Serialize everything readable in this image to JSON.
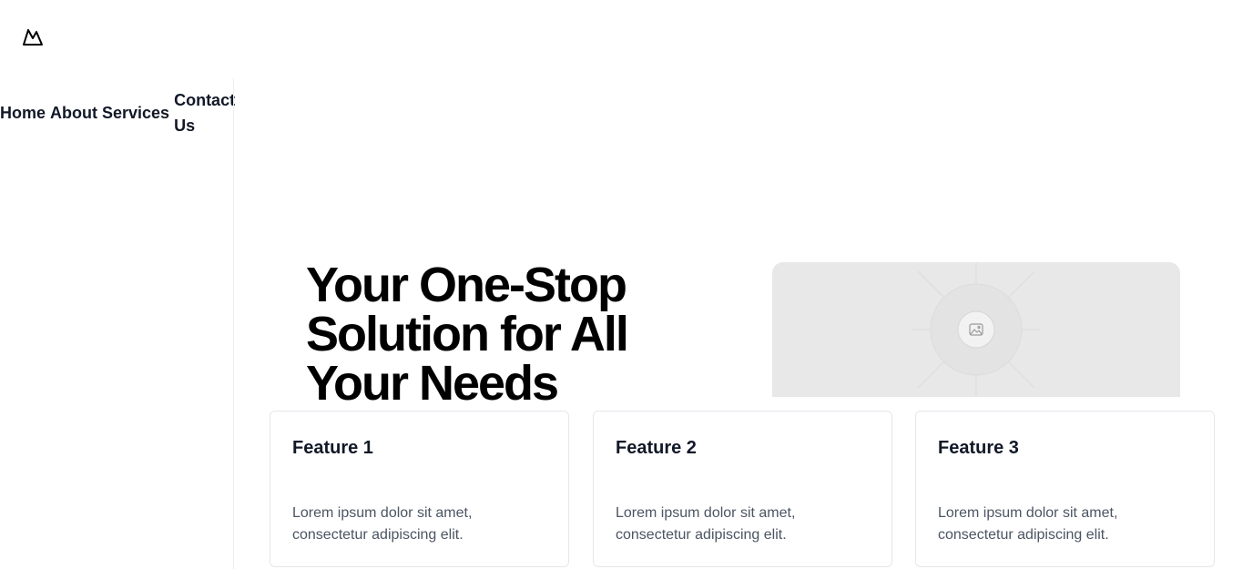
{
  "header": {
    "logo_icon": "mountain-logo-icon"
  },
  "nav": {
    "items": [
      {
        "label": "Home"
      },
      {
        "label": "About"
      },
      {
        "label": "Services"
      },
      {
        "label": "Contact Us"
      }
    ]
  },
  "hero": {
    "title": "Your One-Stop Solution for All Your Needs",
    "image_icon": "image-placeholder-icon"
  },
  "features": [
    {
      "title": "Feature 1",
      "description": "Lorem ipsum dolor sit amet, consectetur adipiscing elit."
    },
    {
      "title": "Feature 2",
      "description": "Lorem ipsum dolor sit amet, consectetur adipiscing elit."
    },
    {
      "title": "Feature 3",
      "description": "Lorem ipsum dolor sit amet, consectetur adipiscing elit."
    }
  ],
  "colors": {
    "text": "#111827",
    "muted_text": "#4b5563",
    "placeholder_bg": "#e8e8e8",
    "border": "#e5e7eb"
  }
}
